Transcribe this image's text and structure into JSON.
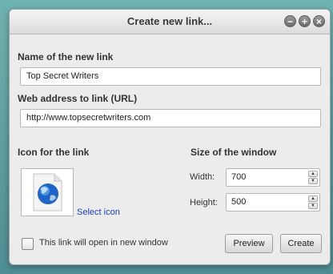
{
  "dialog": {
    "title": "Create new link...",
    "window_buttons": {
      "minimize": "−",
      "maximize": "+",
      "close": "×"
    }
  },
  "form": {
    "name_label": "Name of the new link",
    "name_value": "Top Secret Writers",
    "url_label": "Web address to link (URL)",
    "url_value": "http://www.topsecretwriters.com",
    "icon_label": "Icon for the link",
    "icon_name": "globe-document-icon",
    "select_icon_label": "Select icon",
    "size_label": "Size of the window",
    "width_label": "Width:",
    "width_value": "700",
    "height_label": "Height:",
    "height_value": "500",
    "new_window_label": "This link will open in new window",
    "new_window_checked": false
  },
  "buttons": {
    "preview": "Preview",
    "create": "Create"
  },
  "colors": {
    "link": "#1a3fbf",
    "dialog_bg": "#ececec",
    "desktop": "#5f9ea0"
  }
}
